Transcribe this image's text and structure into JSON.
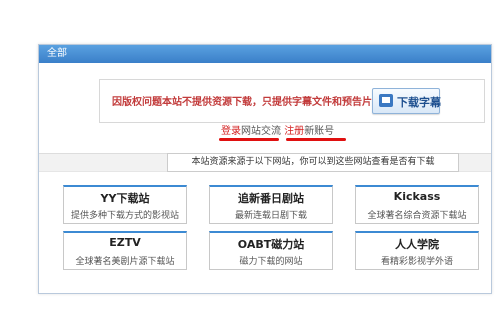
{
  "tab": {
    "label": "全部"
  },
  "notice": {
    "text": "因版权问题本站不提供资源下载，只提供字幕文件和预告片",
    "download_label": "下载字幕"
  },
  "links": {
    "login": "登录",
    "login_rest": "网站交流 ",
    "register": "注册",
    "register_rest": "新账号"
  },
  "section": {
    "label": "本站资源来源于以下网站，你可以到这些网站查看是否有下载"
  },
  "sites": [
    {
      "title": "YY下载站",
      "desc": "提供多种下载方式的影视站"
    },
    {
      "title": "追新番日剧站",
      "desc": "最新连载日剧下载"
    },
    {
      "title": "Kickass",
      "desc": "全球著名综合资源下载站"
    },
    {
      "title": "EZTV",
      "desc": "全球著名美剧片源下载站"
    },
    {
      "title": "OABT磁力站",
      "desc": "磁力下载的网站"
    },
    {
      "title": "人人学院",
      "desc": "看精彩影视学外语"
    }
  ],
  "colors": {
    "accent": "#3c8ad3",
    "notice_red": "#c23b3b",
    "underline_red": "#e01010"
  }
}
